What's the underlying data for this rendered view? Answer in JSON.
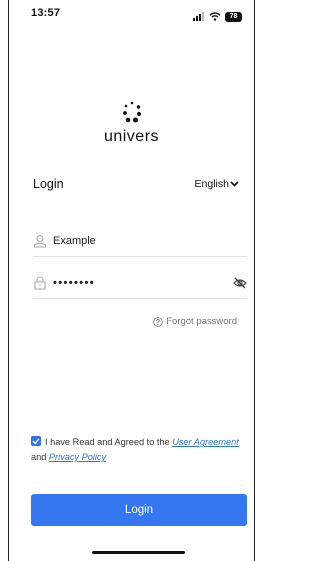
{
  "status_bar": {
    "time": "13:57",
    "battery": "78"
  },
  "logo": {
    "text": "univers"
  },
  "login": {
    "title": "Login",
    "language": "English"
  },
  "form": {
    "username_value": "Example",
    "password_masked": "••••••••",
    "forgot_password": "Forgot password"
  },
  "agreement": {
    "checked": true,
    "prefix": "I have Read and Agreed to the ",
    "user_agreement": "User Agreement",
    "and": " and ",
    "privacy_policy": "Privacy Policy"
  },
  "button": {
    "login_label": "Login"
  },
  "colors": {
    "accent": "#3477f0"
  }
}
